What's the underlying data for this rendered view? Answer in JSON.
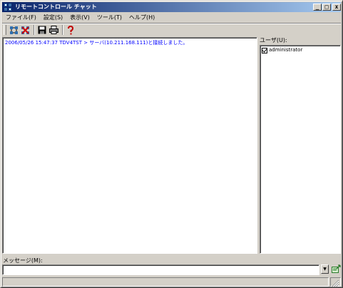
{
  "window": {
    "title": "リモートコントロール チャット",
    "minimize": "_",
    "maximize": "□",
    "close": "x"
  },
  "menu": [
    {
      "label": "ファイル(F)"
    },
    {
      "label": "設定(S)"
    },
    {
      "label": "表示(V)"
    },
    {
      "label": "ツール(T)"
    },
    {
      "label": "ヘルプ(H)"
    }
  ],
  "toolbar": {
    "icons": [
      "connect-icon",
      "disconnect-icon",
      "save-icon",
      "print-icon",
      "help-icon"
    ]
  },
  "chat": {
    "lines": [
      "2006/05/26 15:47:37 TDV4TST > サーバ(10.211.168.111)と接続しました。"
    ],
    "text_color": "#0000ff"
  },
  "users": {
    "label": "ユーザ(U):",
    "items": [
      {
        "name": "administrator",
        "checked": true
      }
    ]
  },
  "message": {
    "label": "メッセージ(M):",
    "value": "",
    "dropdown_glyph": "▼"
  },
  "colors": {
    "titlebar_start": "#0a246a",
    "titlebar_end": "#a6caf0",
    "face": "#d4d0c8"
  }
}
